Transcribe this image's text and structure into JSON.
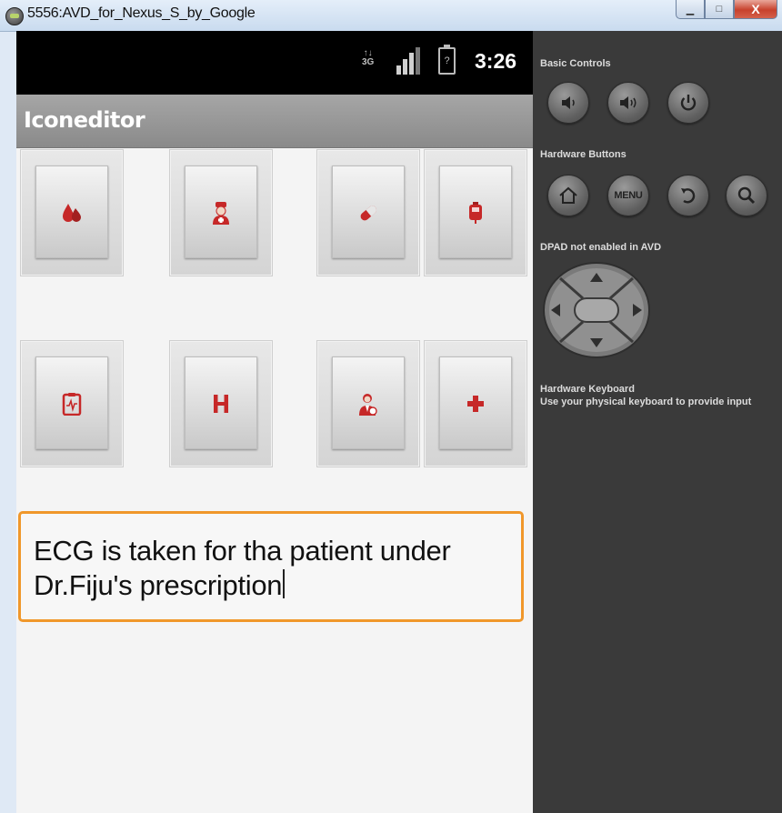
{
  "window": {
    "title": "5556:AVD_for_Nexus_S_by_Google",
    "minimize_label": "▁",
    "maximize_label": "□",
    "close_label": "X"
  },
  "status_bar": {
    "network": "3G",
    "time": "3:26",
    "battery_symbol": "?"
  },
  "app": {
    "title": "Iconeditor",
    "icons": [
      {
        "name": "blood-drop-icon"
      },
      {
        "name": "nurse-icon"
      },
      {
        "name": "pills-icon"
      },
      {
        "name": "blood-bag-icon"
      },
      {
        "name": "ecg-clipboard-icon"
      },
      {
        "name": "hospital-h-icon"
      },
      {
        "name": "doctor-icon"
      },
      {
        "name": "red-cross-icon"
      }
    ],
    "colors": {
      "icon_red": "#c62828",
      "focus_orange": "#f0972a"
    },
    "textbox": {
      "line1": "ECG is taken for tha patient under",
      "line2": "Dr.Fiju's prescription"
    }
  },
  "controls": {
    "basic_controls_label": "Basic Controls",
    "hardware_buttons_label": "Hardware Buttons",
    "menu_label": "MENU",
    "dpad_label": "DPAD not enabled in AVD",
    "keyboard_title": "Hardware Keyboard",
    "keyboard_hint": "Use your physical keyboard to provide input"
  }
}
